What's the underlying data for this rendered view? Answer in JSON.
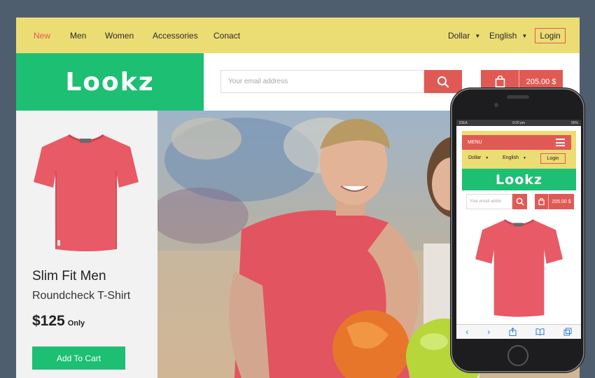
{
  "nav": {
    "items": [
      "New",
      "Men",
      "Women",
      "Accessories",
      "Conact"
    ],
    "active_index": 0,
    "currency": "Dollar",
    "language": "English",
    "login": "Login"
  },
  "brand": {
    "logo": "Lookz"
  },
  "search": {
    "placeholder": "Your email address",
    "icon": "search-icon"
  },
  "cart": {
    "amount": "205.00 $",
    "icon": "shopping-bag-icon"
  },
  "product": {
    "title": "Slim Fit Men",
    "subtitle": "Roundcheck T-Shirt",
    "price": "$125",
    "price_note": "Only",
    "cta": "Add To Cart",
    "shirt_color": "#e85a66"
  },
  "mobile": {
    "status_carrier": "IDEA",
    "status_time": "9:20 pm",
    "status_battery": "90%",
    "menu": "MENU",
    "currency": "Dollar",
    "language": "English",
    "login": "Login",
    "logo": "Lookz",
    "search_placeholder": "Your email addre",
    "cart_amount": "205.00 $"
  },
  "colors": {
    "nav_bg": "#ecdc74",
    "accent_red": "#e05a55",
    "brand_green": "#1dbf73",
    "page_bg": "#4f5e6e"
  }
}
